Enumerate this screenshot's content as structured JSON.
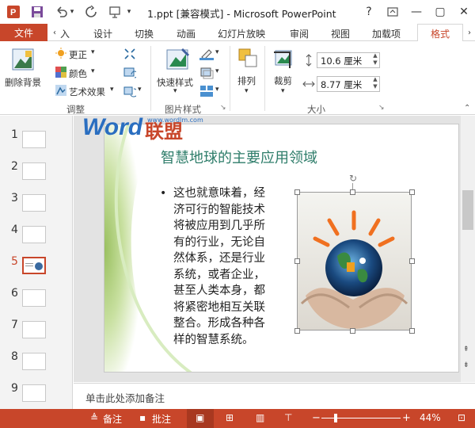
{
  "titlebar": {
    "title": "1.ppt [兼容模式] - Microsoft PowerPoint",
    "help": "?",
    "window_controls": [
      "—",
      "▢",
      "✕"
    ]
  },
  "tabs": {
    "file": "文件",
    "items": [
      "入",
      "设计",
      "切换",
      "动画",
      "幻灯片放映",
      "审阅",
      "视图",
      "加载项"
    ],
    "active": "格式"
  },
  "ribbon": {
    "remove_bg": "删除背景",
    "correct": "更正",
    "color": "颜色",
    "artistic": "艺术效果",
    "group_adjust": "调整",
    "quick_styles": "快速样式",
    "group_pic_styles": "图片样式",
    "arrange": "排列",
    "crop": "裁剪",
    "height": "10.6 厘米",
    "width": "8.77 厘米",
    "group_size": "大小"
  },
  "thumbnails": [
    "1",
    "2",
    "3",
    "4",
    "5",
    "6",
    "7",
    "8",
    "9"
  ],
  "selected_slide": "5",
  "slide": {
    "watermark_word": "Word",
    "watermark_cn": "联盟",
    "watermark_url": "www.wordlm.com",
    "title": "智慧地球的主要应用领域",
    "bullet": "•",
    "body_lines": [
      "这也就意味着，经",
      "济可行的智能技术",
      "将被应用到几乎所",
      "有的行业，无论自",
      "然体系，还是行业",
      "系统，或者企业，",
      "甚至人类本身，都",
      "将紧密地相互关联",
      "整合。形成各种各",
      "样的智慧系统。"
    ]
  },
  "notes": {
    "placeholder": "单击此处添加备注"
  },
  "statusbar": {
    "notes": "备注",
    "comments": "批注",
    "zoom": "44%"
  },
  "colors": {
    "accent": "#c8462a",
    "slide_title": "#2e7d6a"
  }
}
